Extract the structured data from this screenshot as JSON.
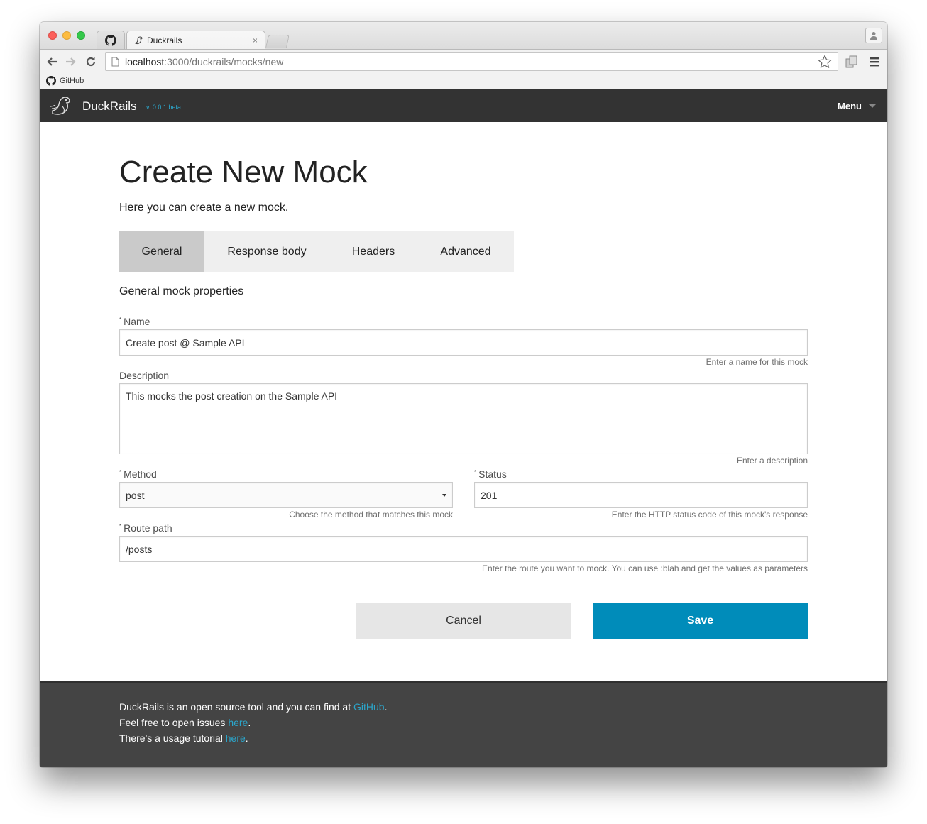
{
  "browser": {
    "tab_title": "Duckrails",
    "tab_close": "×",
    "url_host": "localhost",
    "url_path": ":3000/duckrails/mocks/new",
    "bookmark_label": "GitHub"
  },
  "navbar": {
    "brand": "DuckRails",
    "version": "v. 0.0.1 beta",
    "menu_label": "Menu"
  },
  "page": {
    "title": "Create New Mock",
    "subtitle": "Here you can create a new mock."
  },
  "tabs": [
    {
      "label": "General"
    },
    {
      "label": "Response body"
    },
    {
      "label": "Headers"
    },
    {
      "label": "Advanced"
    }
  ],
  "form": {
    "section_title": "General mock properties",
    "required_marker": "*",
    "name": {
      "label": "Name",
      "value": "Create post @ Sample API",
      "hint": "Enter a name for this mock"
    },
    "description": {
      "label": "Description",
      "value": "This mocks the post creation on the Sample API",
      "hint": "Enter a description"
    },
    "method": {
      "label": "Method",
      "value": "post",
      "hint": "Choose the method that matches this mock"
    },
    "status": {
      "label": "Status",
      "value": "201",
      "hint": "Enter the HTTP status code of this mock's response"
    },
    "route": {
      "label": "Route path",
      "value": "/posts",
      "hint": "Enter the route you want to mock. You can use :blah and get the values as parameters"
    },
    "cancel_label": "Cancel",
    "save_label": "Save"
  },
  "footer": {
    "line1_text": "DuckRails is an open source tool and you can find at ",
    "line1_link": "GitHub",
    "line1_end": ".",
    "line2_text": "Feel free to open issues ",
    "line2_link": "here",
    "line2_end": ".",
    "line3_text": "There's a usage tutorial ",
    "line3_link": "here",
    "line3_end": "."
  },
  "colors": {
    "navbar_bg": "#333333",
    "accent": "#008cba",
    "link": "#2ba6cb",
    "footer_bg": "#444444",
    "active_tab_bg": "#cacaca"
  }
}
